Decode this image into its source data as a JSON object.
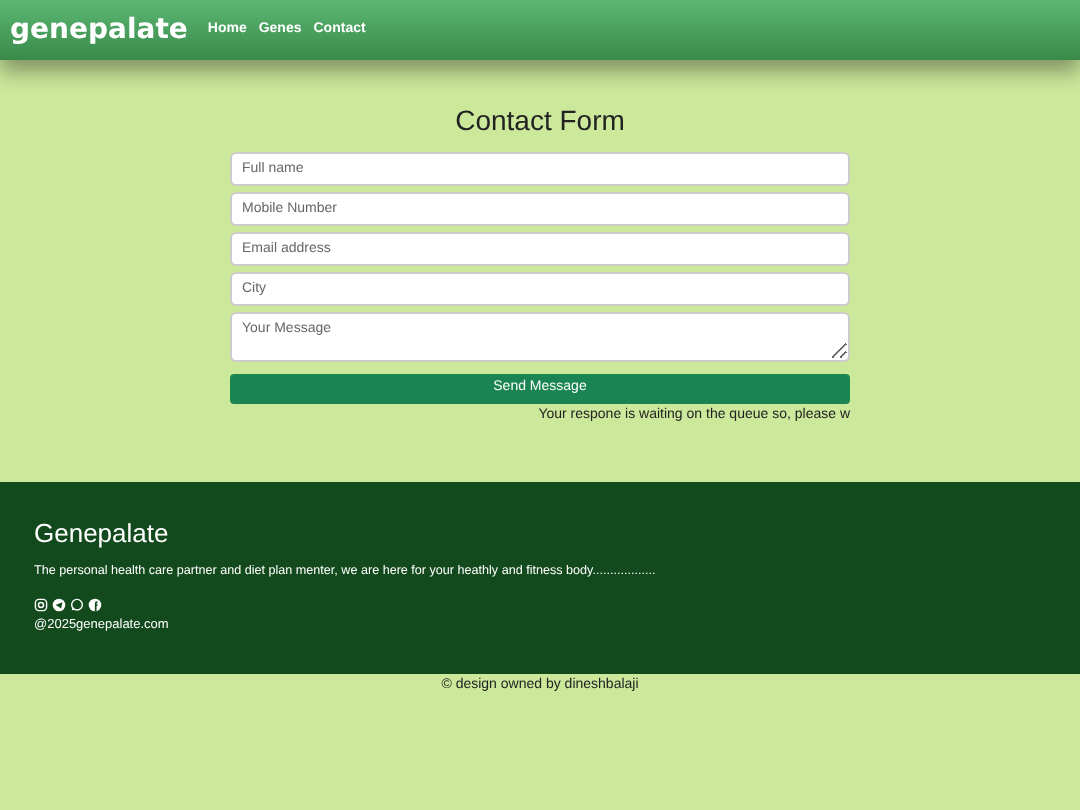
{
  "nav": {
    "brand": "genepalate",
    "links": [
      "Home",
      "Genes",
      "Contact"
    ]
  },
  "form": {
    "title": "Contact Form",
    "fields": [
      {
        "kind": "input",
        "placeholder": "Full name"
      },
      {
        "kind": "input",
        "placeholder": "Mobile Number"
      },
      {
        "kind": "input",
        "placeholder": "Email address"
      },
      {
        "kind": "input",
        "placeholder": "City"
      },
      {
        "kind": "textarea",
        "placeholder": "Your Message"
      }
    ],
    "button": "Send Message",
    "status": "Your respone is waiting on the queue so, please w"
  },
  "footer": {
    "title": "Genepalate",
    "text": "The personal health care partner and diet plan menter, we are here for your heathly and fitness body..................",
    "social": [
      {
        "kind": "instagram"
      },
      {
        "kind": "telegram"
      },
      {
        "kind": "whatsapp"
      },
      {
        "kind": "facebook"
      }
    ],
    "email": "@2025genepalate.com"
  },
  "credit": "© design owned by dineshbalaji"
}
